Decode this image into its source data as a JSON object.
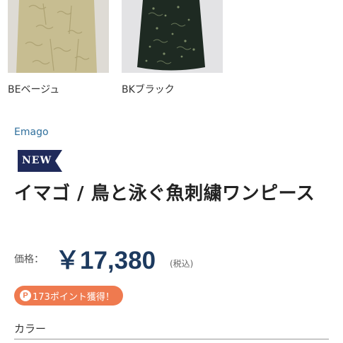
{
  "variants": [
    {
      "code": "BE",
      "label": "BEベージュ",
      "color": "#c7bd91"
    },
    {
      "code": "BK",
      "label": "BKブラック",
      "color": "#1e2a22"
    }
  ],
  "product": {
    "brand": "Emago",
    "badge": "NEW",
    "title": "イマゴ / 鳥と泳ぐ魚刺繍ワンピース",
    "price_label": "価格：",
    "price": "￥17,380",
    "tax_note": "(税込)",
    "points_icon": "P",
    "points_text": "173ポイント獲得！"
  },
  "options": {
    "color_label": "カラー"
  },
  "colors": {
    "brand_link": "#2f6f9c",
    "price": "#1d3a5f",
    "points_pill": "#ef7a4f",
    "new_badge": "#1f2a5a"
  }
}
